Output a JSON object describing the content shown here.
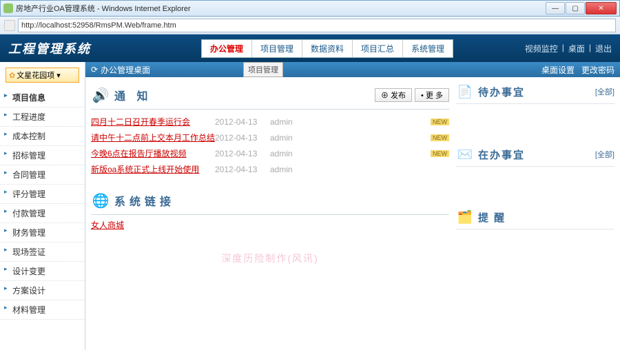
{
  "window": {
    "title": "房地产行业OA管理系统 - Windows Internet Explorer",
    "url": "http://localhost:52958/RmsPM.Web/frame.htm"
  },
  "header": {
    "logo": "工程管理系统",
    "tabs": [
      "办公管理",
      "项目管理",
      "数据资料",
      "项目汇总",
      "系统管理"
    ],
    "tooltip": "项目管理",
    "right": [
      "视频监控",
      "桌面",
      "退出"
    ]
  },
  "sidebar": {
    "dropdown": "文星花园项 ▾",
    "items": [
      "项目信息",
      "工程进度",
      "成本控制",
      "招标管理",
      "合同管理",
      "评分管理",
      "付款管理",
      "财务管理",
      "现场签证",
      "设计变更",
      "方案设计",
      "材料管理"
    ]
  },
  "crumb": {
    "title": "办公管理桌面",
    "right": [
      "桌面设置",
      "更改密码"
    ]
  },
  "notices": {
    "title": "通 知",
    "publish": "⊕ 发布",
    "more": "• 更 多",
    "rows": [
      {
        "title": "四月十二日召开春季运行会",
        "date": "2012-04-13",
        "author": "admin",
        "badge": "NEW"
      },
      {
        "title": "请中午十二点前上交本月工作总结",
        "date": "2012-04-13",
        "author": "admin",
        "badge": "NEW"
      },
      {
        "title": "今晚6点在报告厅播放视频",
        "date": "2012-04-13",
        "author": "admin",
        "badge": "NEW"
      },
      {
        "title": "新版oa系统正式上线开始使用",
        "date": "2012-04-13",
        "author": "admin",
        "badge": ""
      }
    ]
  },
  "syslinks": {
    "title": "系统链接",
    "items": [
      "女人商城"
    ]
  },
  "watermark": "深度历险制作(风讯)",
  "cards": {
    "todo": {
      "title": "待办事宜",
      "more": "[全部]"
    },
    "doing": {
      "title": "在办事宜",
      "more": "[全部]"
    },
    "remind": {
      "title": "提 醒",
      "more": ""
    }
  }
}
